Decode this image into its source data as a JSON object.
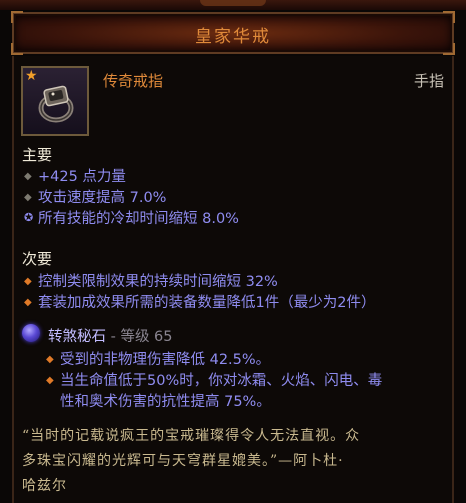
{
  "title_bar": {
    "title": "皇家华戒"
  },
  "item": {
    "name": "传奇戒指",
    "slot": "手指",
    "icon": "ring-icon",
    "rarity_icon": "star-icon"
  },
  "primary": {
    "heading": "主要",
    "stats": [
      {
        "text": "+425 点力量",
        "icon": "diamond-bullet-icon"
      },
      {
        "text": "攻击速度提高 7.0%",
        "icon": "diamond-bullet-icon"
      },
      {
        "text": "所有技能的冷却时间缩短 8.0%",
        "icon": "swirl-bullet-icon"
      }
    ]
  },
  "secondary": {
    "heading": "次要",
    "stats": [
      {
        "text": "控制类限制效果的持续时间缩短 32%",
        "icon": "orange-diamond-icon"
      },
      {
        "text": "套装加成效果所需的装备数量降低1件（最少为2件）",
        "icon": "orange-diamond-icon"
      }
    ]
  },
  "gem": {
    "name": "转煞秘石",
    "level_text": " - 等级 65",
    "effects": [
      "受到的非物理伤害降低 42.5%。",
      "当生命值低于50%时，你对冰霜、火焰、闪电、毒",
      "性和奥术伤害的抗性提高 75%。"
    ]
  },
  "flavor": {
    "lines": [
      "“当时的记载说疯王的宝戒璀璨得令人无法直视。众",
      "多珠宝闪耀的光辉可与天穹群星媲美。”—阿卜杜·",
      "哈兹尔"
    ]
  },
  "colors": {
    "title": "#e08a3a",
    "primary_stat": "#8f8cf0",
    "secondary_bullet": "#e07a28",
    "flavor": "#c9b98f"
  }
}
